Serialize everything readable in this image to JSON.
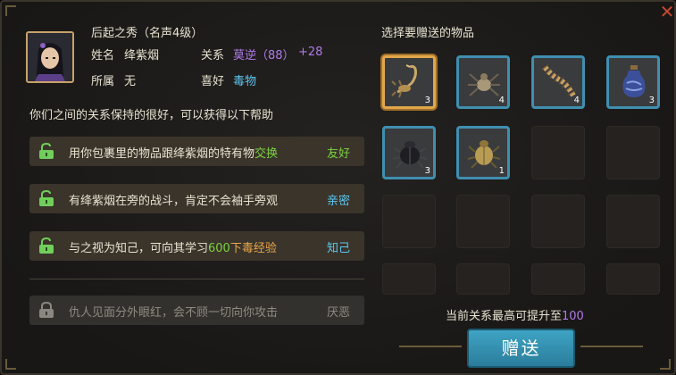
{
  "character": {
    "title": "后起之秀（名声4级）",
    "name_label": "姓名",
    "name": "绛紫烟",
    "relation_label": "关系",
    "relation": "莫逆（88）",
    "relation_bonus": "+28",
    "affiliation_label": "所属",
    "affiliation": "无",
    "hobby_label": "喜好",
    "hobby": "毒物"
  },
  "help_intro": "你们之间的关系保持的很好，可以获得以下帮助",
  "benefits": [
    {
      "text_a": "用你包裹里的物品跟绛紫烟的特有物",
      "text_b": "交换",
      "text_c": "",
      "tag": "友好"
    },
    {
      "text_a": "有绛紫烟在旁的战斗，肯定不会袖手旁观",
      "text_b": "",
      "text_c": "",
      "tag": "亲密"
    },
    {
      "text_a": "与之视为知己，可向其学习",
      "text_b": "600",
      "text_c": "下毒经验",
      "tag": "知己"
    },
    {
      "text_a": "仇人见面分外眼红，会不顾一切向你攻击",
      "text_b": "",
      "text_c": "",
      "tag": "厌恶"
    }
  ],
  "gift_title": "选择要赠送的物品",
  "items": [
    {
      "icon": "scorpion-icon",
      "count": "3"
    },
    {
      "icon": "spider-icon",
      "count": "4"
    },
    {
      "icon": "centipede-icon",
      "count": "4"
    },
    {
      "icon": "poison-jar-icon",
      "count": "3"
    },
    {
      "icon": "black-beetle-icon",
      "count": "3"
    },
    {
      "icon": "gold-beetle-icon",
      "count": "1"
    }
  ],
  "max_relation_text": "当前关系最高可提升至",
  "max_relation_value": "100",
  "gift_button": "赠送",
  "colors": {
    "accent_blue": "#3f8fb0",
    "selected_gold": "#e0a84a",
    "purple": "#b07ae8",
    "green": "#7bd23f"
  }
}
